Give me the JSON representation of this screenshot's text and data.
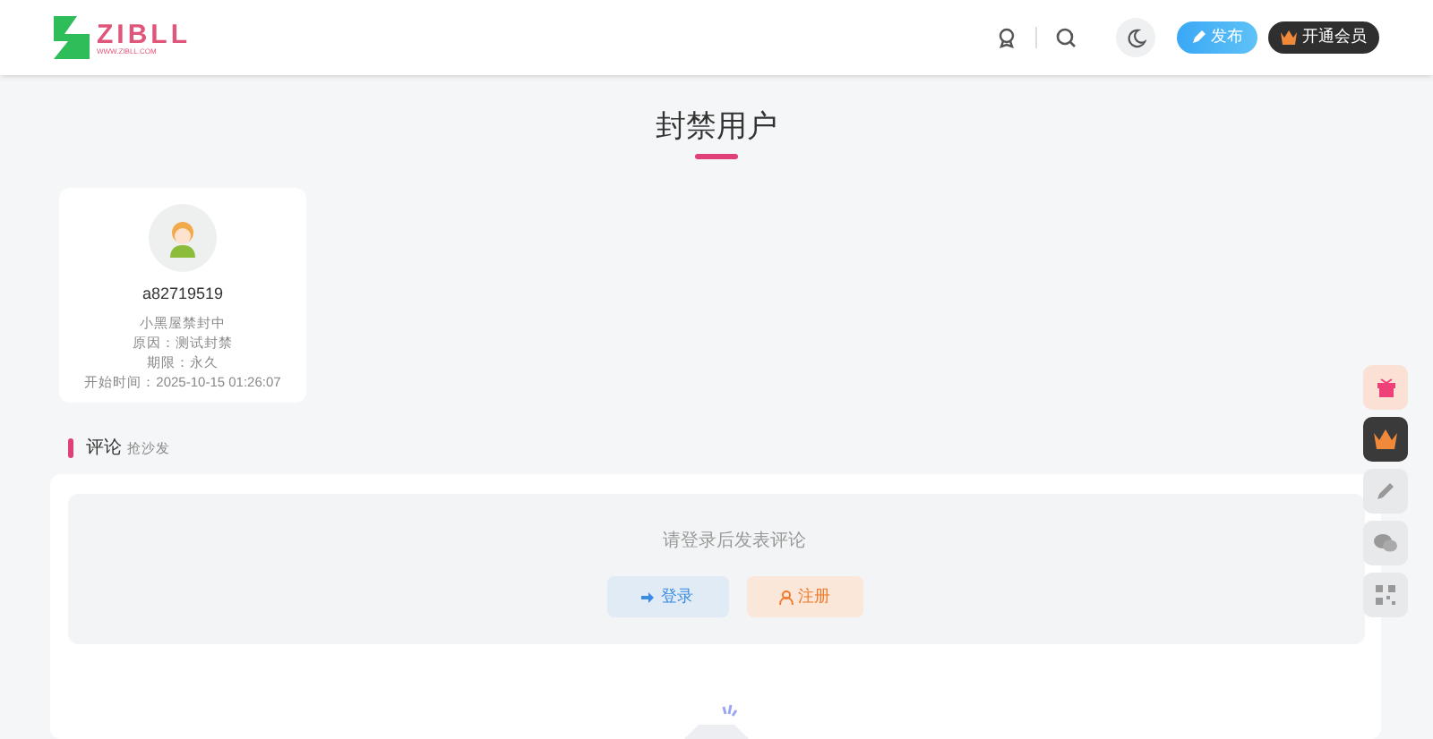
{
  "header": {
    "logo_text": "ZIBLL",
    "logo_subtext": "WWW.ZIBLL.COM",
    "publish_button": "发布",
    "vip_button": "开通会员"
  },
  "page_title": "封禁用户",
  "user_card": {
    "username": "a82719519",
    "lines": [
      "小黑屋禁封中",
      "原因：测试封禁",
      "期限：永久",
      "开始时间：2025-10-15 01:26:07"
    ]
  },
  "comments": {
    "title": "评论",
    "subtitle": "抢沙发",
    "login_prompt": "请登录后发表评论",
    "login_button": "登录",
    "register_button": "注册"
  },
  "float_buttons": [
    {
      "kind": "gift"
    },
    {
      "kind": "crown"
    },
    {
      "kind": "pencil"
    },
    {
      "kind": "chat"
    },
    {
      "kind": "qrcode"
    }
  ]
}
